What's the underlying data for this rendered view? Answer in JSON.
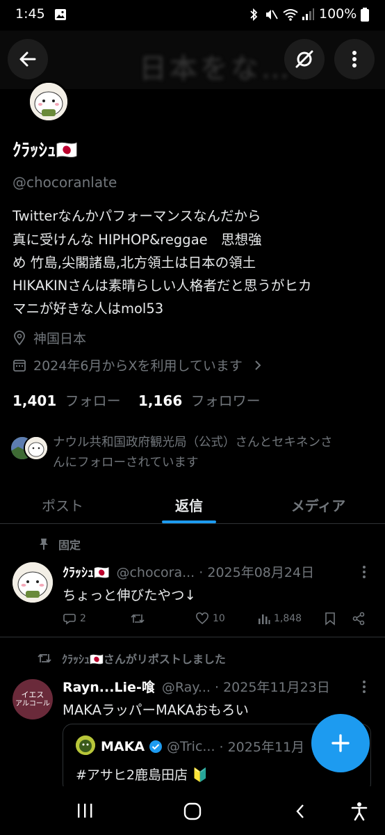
{
  "status_bar": {
    "time": "1:45",
    "battery": "100%"
  },
  "banner": {
    "blurred_text": "日本をな…"
  },
  "profile": {
    "display_name": "ｸﾗｯｼｭ🇯🇵",
    "handle": "@chocoranlate",
    "bio_lines": [
      "Twitterなんかパフォーマンスなんだから",
      "真に受けんな  HIPHOP&reggae　思想強",
      "め 竹島,尖閣諸島,北方領土は日本の領土",
      "HIKAKINさんは素晴らしい人格者だと思うがヒカ",
      "マニが好きな人はmol53"
    ],
    "location": "神国日本",
    "joined": "2024年6月からXを利用しています",
    "following_count": "1,401",
    "following_label": "フォロー",
    "followers_count": "1,166",
    "followers_label": "フォロワー",
    "followed_by_line1": "ナウル共和国政府観光局（公式）さんとセキネンさ",
    "followed_by_line2": "んにフォローされています"
  },
  "tabs": [
    "ポスト",
    "返信",
    "メディア"
  ],
  "active_tab": 1,
  "pinned_tweet": {
    "pinned_label": "固定",
    "name": "ｸﾗｯｼｭ🇯🇵",
    "handle": "@chocora...",
    "date": "· 2025年08月24日",
    "text": "ちょっと伸びたやつ↓",
    "replies": "2",
    "retweets": "",
    "likes": "10",
    "views": "1,848"
  },
  "repost": {
    "repost_label": "ｸﾗｯｼｭ🇯🇵さんがリポストしました",
    "name": "Rayn...Lie-喰",
    "handle": "@Ray...",
    "date": "· 2025年11月23日",
    "text": "MAKAラッパーMAKAおもろい",
    "avatar_text_1": "イエス",
    "avatar_text_2": "アルコール",
    "quote_name": "MAKA",
    "quote_handle": "@Tric...",
    "quote_date": "· 2025年11月",
    "quote_text": "#アサヒ2鹿島田店 🔰"
  },
  "colors": {
    "background": "#000000",
    "accent": "#1d9bf0",
    "muted": "#71767b",
    "text": "#e7e9ea",
    "divider": "#2f3336"
  }
}
